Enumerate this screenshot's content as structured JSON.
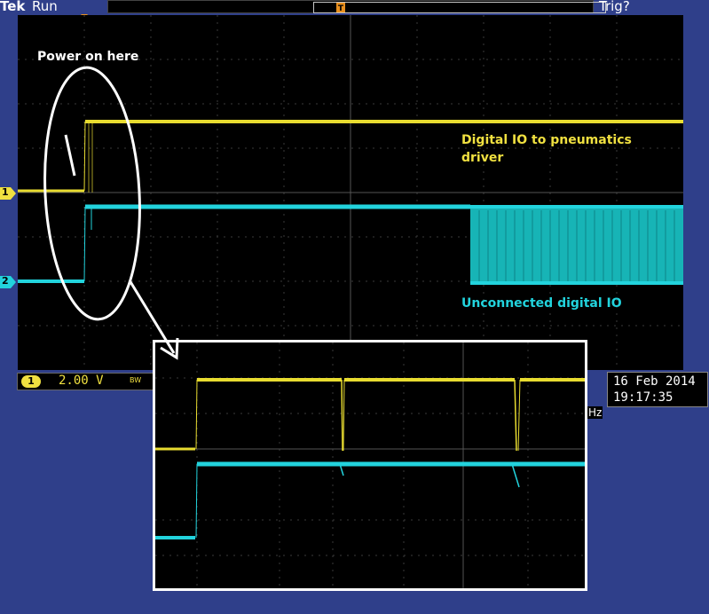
{
  "header": {
    "brand": "Tek",
    "run_state": "Run",
    "trigger_status": "Trig?"
  },
  "annotations": {
    "power_on": "Power on here",
    "digital_io_line1": "Digital IO to pneumatics",
    "digital_io_line2": "driver",
    "unconnected": "Unconnected digital IO"
  },
  "channels": {
    "ch1_marker": "1",
    "ch2_marker": "2",
    "ch1_color": "#f0e040",
    "ch2_color": "#22d3dd"
  },
  "status": {
    "channel_badge": "1",
    "scale": "2.00 V",
    "bandwidth": "BW",
    "frequency_fragment": "Hz"
  },
  "datetime": {
    "date": "16 Feb  2014",
    "time": "19:17:35"
  },
  "icons": {
    "trigger": "trigger-position-icon",
    "record": "record-window-icon"
  }
}
